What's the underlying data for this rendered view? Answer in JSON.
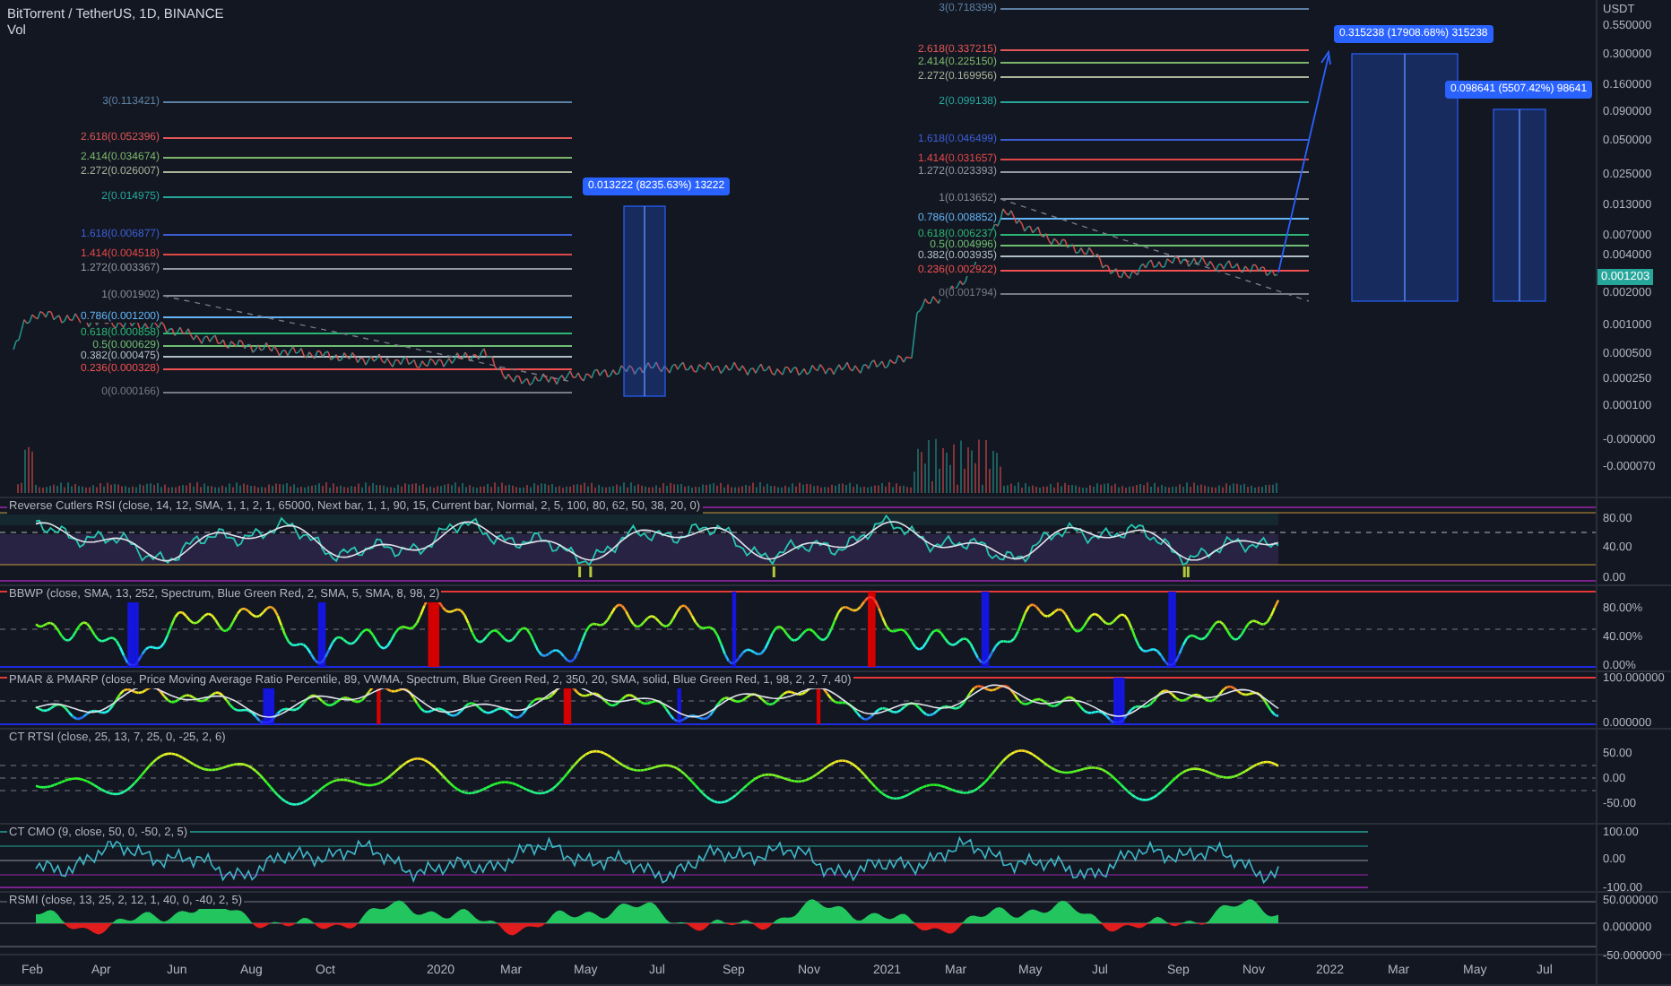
{
  "chart": {
    "title": "BitTorrent / TetherUS, 1D, BINANCE",
    "volume_label": "Vol",
    "fib_sets": [
      {
        "levels": [
          {
            "label": "3(0.113421)",
            "color": "#5d7fa3"
          },
          {
            "label": "2.618(0.052396)",
            "color": "#e05656"
          },
          {
            "label": "2.414(0.034674)",
            "color": "#7cb56a"
          },
          {
            "label": "2.272(0.026007)",
            "color": "#a9b49a"
          },
          {
            "label": "2(0.014975)",
            "color": "#26a69a"
          },
          {
            "label": "1.618(0.006877)",
            "color": "#3d5fd6"
          },
          {
            "label": "1.414(0.004518)",
            "color": "#e04848"
          },
          {
            "label": "1.272(0.003367)",
            "color": "#9598a1"
          },
          {
            "label": "1(0.001902)",
            "color": "#8a8d96"
          },
          {
            "label": "0.786(0.001200)",
            "color": "#64b5f6"
          },
          {
            "label": "0.618(0.000858)",
            "color": "#2bb673"
          },
          {
            "label": "0.5(0.000629)",
            "color": "#6fbf73"
          },
          {
            "label": "0.382(0.000475)",
            "color": "#b0bec5"
          },
          {
            "label": "0.236(0.000328)",
            "color": "#f05050"
          },
          {
            "label": "0(0.000166)",
            "color": "#787b86"
          }
        ]
      },
      {
        "levels": [
          {
            "label": "3(0.718399)",
            "color": "#5d7fa3"
          },
          {
            "label": "2.618(0.337215)",
            "color": "#e05656"
          },
          {
            "label": "2.414(0.225150)",
            "color": "#7cb56a"
          },
          {
            "label": "2.272(0.169956)",
            "color": "#a9b49a"
          },
          {
            "label": "2(0.099138)",
            "color": "#26a69a"
          },
          {
            "label": "1.618(0.046499)",
            "color": "#3d5fd6"
          },
          {
            "label": "1.414(0.031657)",
            "color": "#e04848"
          },
          {
            "label": "1.272(0.023393)",
            "color": "#9598a1"
          },
          {
            "label": "1(0.013652)",
            "color": "#8a8d96"
          },
          {
            "label": "0.786(0.008852)",
            "color": "#64b5f6"
          },
          {
            "label": "0.618(0.006237)",
            "color": "#2bb673"
          },
          {
            "label": "0.5(0.004996)",
            "color": "#6fbf73"
          },
          {
            "label": "0.382(0.003935)",
            "color": "#b0bec5"
          },
          {
            "label": "0.236(0.002922)",
            "color": "#f05050"
          },
          {
            "label": "0(0.001794)",
            "color": "#787b86"
          }
        ]
      }
    ],
    "measurements": [
      {
        "label": "0.013222 (8235.63%) 13222"
      },
      {
        "label": "0.315238 (17908.68%) 315238"
      },
      {
        "label": "0.098641 (5507.42%) 98641"
      }
    ],
    "price_axis": {
      "unit": "USDT",
      "ticks": [
        "0.550000",
        "0.300000",
        "0.160000",
        "0.090000",
        "0.050000",
        "0.025000",
        "0.013000",
        "0.007000",
        "0.004000",
        "0.002000",
        "0.001000",
        "0.000500",
        "0.000250",
        "0.000100",
        "-0.000000",
        "-0.000070"
      ],
      "current_price": "0.001203"
    }
  },
  "indicators": [
    {
      "kind": "rsi",
      "title": "Reverse Cutlers RSI (close, 14, 12, SMA, 1, 1, 2, 1, 65000, Next bar, 1, 1, 90, 15, Current bar, Normal, 2, 5, 100, 80, 62, 50, 38, 20, 0)",
      "axis_ticks": [
        "80.00",
        "40.00",
        "0.00"
      ]
    },
    {
      "kind": "bbwp",
      "title": "BBWP (close, SMA, 13, 252, Spectrum, Blue Green Red, 2, SMA, 5, SMA, 8, 98, 2)",
      "axis_ticks": [
        "80.00%",
        "40.00%",
        "0.00%"
      ]
    },
    {
      "kind": "pmar",
      "title": "PMAR & PMARP (close, Price Moving Average Ratio Percentile, 89, VWMA, Spectrum, Blue Green Red, 2, 350, 20, SMA, solid, Blue Green Red, 1, 98, 2, 2, 7, 40)",
      "axis_ticks": [
        "100.000000",
        "0.000000"
      ]
    },
    {
      "kind": "rtsi",
      "title": "CT RTSI (close, 25, 13, 7, 25, 0, -25, 2, 6)",
      "axis_ticks": [
        "50.00",
        "0.00",
        "-50.00"
      ]
    },
    {
      "kind": "cmo",
      "title": "CT CMO (9, close, 50, 0, -50, 2, 5)",
      "axis_ticks": [
        "100.00",
        "0.00",
        "-100.00"
      ]
    },
    {
      "kind": "rsmi",
      "title": "RSMI (close, 13, 25, 2, 12, 1, 40, 0, -40, 2, 5)",
      "axis_ticks": [
        "50.000000",
        "0.000000",
        "-50.000000"
      ]
    }
  ],
  "time_axis": [
    "Feb",
    "Apr",
    "Jun",
    "Aug",
    "Oct",
    "2020",
    "Mar",
    "May",
    "Jul",
    "Sep",
    "Nov",
    "2021",
    "Mar",
    "May",
    "Jul",
    "Sep",
    "Nov",
    "2022",
    "Mar",
    "May",
    "Jul"
  ]
}
